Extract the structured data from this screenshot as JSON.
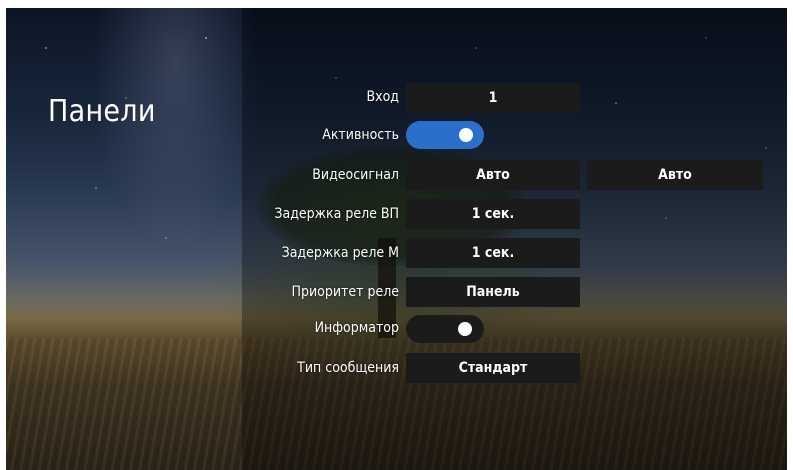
{
  "title": "Панели",
  "settings": {
    "input": {
      "label": "Вход",
      "value": "1"
    },
    "activity": {
      "label": "Активность",
      "on": true
    },
    "video_signal": {
      "label": "Видеосигнал",
      "value1": "Авто",
      "value2": "Авто"
    },
    "relay_delay_vp": {
      "label": "Задержка реле ВП",
      "value": "1 сек."
    },
    "relay_delay_m": {
      "label": "Задержка реле М",
      "value": "1 сек."
    },
    "relay_priority": {
      "label": "Приоритет реле",
      "value": "Панель"
    },
    "informer": {
      "label": "Информатор",
      "on": true
    },
    "message_type": {
      "label": "Тип сообщения",
      "value": "Стандарт"
    }
  },
  "colors": {
    "toggle_on": "#2a6fc9",
    "toggle_dark": "#1b1b1b",
    "value_box": "#1b1b1b",
    "text": "#ffffff"
  }
}
